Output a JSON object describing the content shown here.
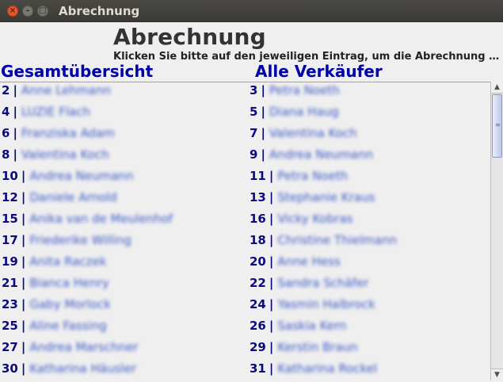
{
  "window": {
    "title": "Abrechnung",
    "close_glyph": "×",
    "min_glyph": "–",
    "max_glyph": "□"
  },
  "header": {
    "title": "Abrechnung",
    "instruction": "Klicken Sie bitte auf den jeweiligen Eintrag, um die Abrechnung daf..."
  },
  "links": {
    "overview": "Gesamtübersicht",
    "all_sellers": "Alle Verkäufer"
  },
  "entries_left": [
    {
      "num": "2",
      "name": "Anne Lehmann"
    },
    {
      "num": "4",
      "name": "LUZIE Flach"
    },
    {
      "num": "6",
      "name": "Franziska Adam"
    },
    {
      "num": "8",
      "name": "Valentina Koch"
    },
    {
      "num": "10",
      "name": "Andrea Neumann"
    },
    {
      "num": "12",
      "name": "Daniele Arnold"
    },
    {
      "num": "15",
      "name": "Anika  van de Meulenhof"
    },
    {
      "num": "17",
      "name": "Friederike Willing"
    },
    {
      "num": "19",
      "name": "Anita Raczek"
    },
    {
      "num": "21",
      "name": "Bianca Henry"
    },
    {
      "num": "23",
      "name": "Gaby Morlock"
    },
    {
      "num": "25",
      "name": "Aline Fassing"
    },
    {
      "num": "27",
      "name": "Andrea Marschner"
    },
    {
      "num": "30",
      "name": "Katharina Häusler"
    }
  ],
  "entries_right": [
    {
      "num": "3",
      "name": "Petra Noeth"
    },
    {
      "num": "5",
      "name": "Diana  Haug"
    },
    {
      "num": "7",
      "name": "Valentina Koch"
    },
    {
      "num": "9",
      "name": "Andrea Neumann"
    },
    {
      "num": "11",
      "name": "Petra Noeth"
    },
    {
      "num": "13",
      "name": "Stephanie Kraus"
    },
    {
      "num": "16",
      "name": "Vicky Kobras"
    },
    {
      "num": "18",
      "name": "Christine Thielmann"
    },
    {
      "num": "20",
      "name": "Anne Hess"
    },
    {
      "num": "22",
      "name": "Sandra Schäfer"
    },
    {
      "num": "24",
      "name": "Yasmin Halbrock"
    },
    {
      "num": "26",
      "name": "Saskia Kern"
    },
    {
      "num": "29",
      "name": "Kerstin Braun"
    },
    {
      "num": "31",
      "name": "Katharina Rockel"
    }
  ],
  "entry_separator": "|",
  "scrollbar": {
    "up_glyph": "▲",
    "down_glyph": "▼",
    "grip_glyph": "≡"
  },
  "colors": {
    "link": "#0000a8",
    "titlebar": "#3f3e3a",
    "close_button": "#e9562e"
  }
}
